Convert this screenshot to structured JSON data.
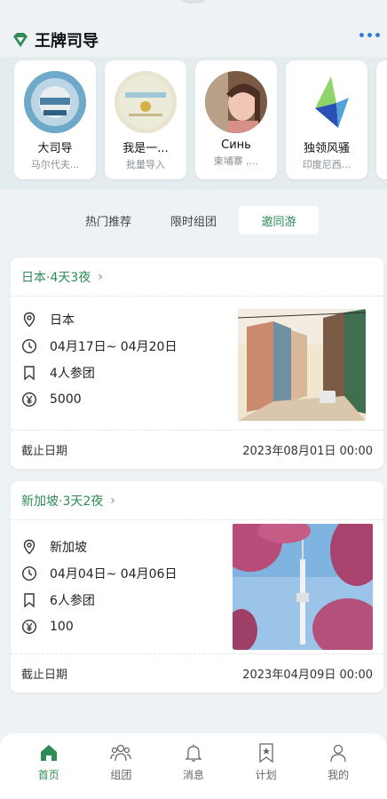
{
  "app": {
    "title": "王牌司导",
    "accent": "#2e8b57"
  },
  "guides": [
    {
      "name": "大司导",
      "sub": "马尔代夫..."
    },
    {
      "name": "我是一...",
      "sub": "批量导入"
    },
    {
      "name": "Синь",
      "sub": "柬埔寨 ,..."
    },
    {
      "name": "独领风骚",
      "sub": "印度尼西..."
    }
  ],
  "tabs": [
    {
      "label": "热门推荐"
    },
    {
      "label": "限时组团"
    },
    {
      "label": "邀同游"
    }
  ],
  "trips": [
    {
      "title": "日本·4天3夜",
      "location": "日本",
      "dates": "04月17日~ 04月20日",
      "group": "4人参团",
      "price": "5000",
      "deadline_label": "截止日期",
      "deadline": "2023年08月01日 00:00"
    },
    {
      "title": "新加坡·3天2夜",
      "location": "新加坡",
      "dates": "04月04日~ 04月06日",
      "group": "6人参团",
      "price": "100",
      "deadline_label": "截止日期",
      "deadline": "2023年04月09日 00:00"
    }
  ],
  "nav": [
    {
      "label": "首页",
      "icon": "home-icon"
    },
    {
      "label": "组团",
      "icon": "group-icon"
    },
    {
      "label": "消息",
      "icon": "bell-icon"
    },
    {
      "label": "计划",
      "icon": "bookmark-icon"
    },
    {
      "label": "我的",
      "icon": "user-icon"
    }
  ]
}
